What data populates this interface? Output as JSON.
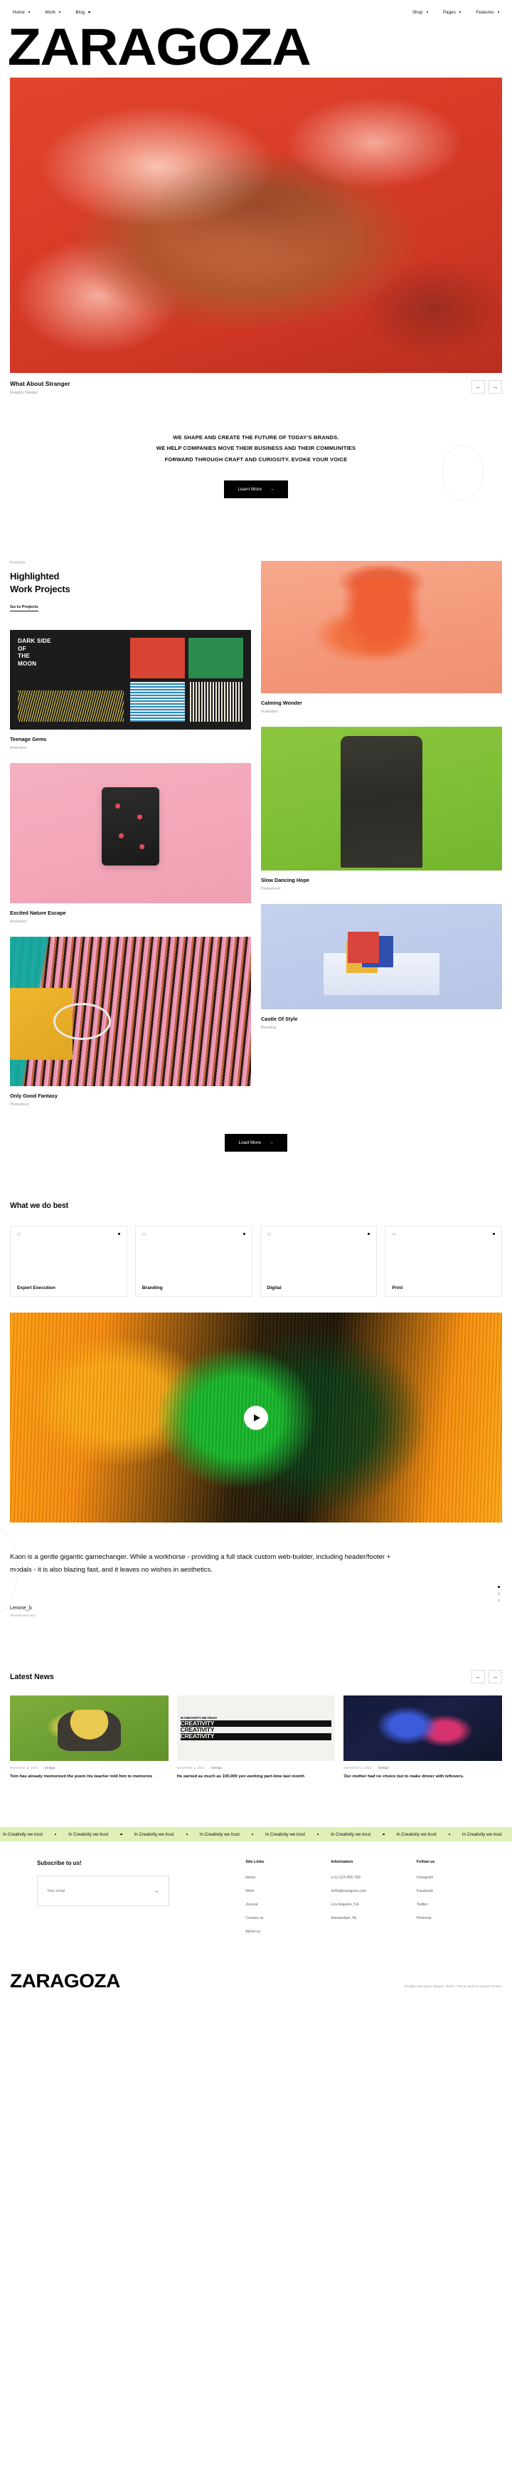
{
  "nav": {
    "left": [
      {
        "label": "Home"
      },
      {
        "label": "Work"
      },
      {
        "label": "Blog"
      }
    ],
    "right": [
      {
        "label": "Shop"
      },
      {
        "label": "Pages"
      },
      {
        "label": "Features"
      }
    ]
  },
  "brand": {
    "wordmark": "ZARAGOZA",
    "footer_logo": "ZARAGOZA"
  },
  "hero": {
    "title": "What About Stranger",
    "category": "Graphic Design",
    "prev_icon": "←",
    "next_icon": "→"
  },
  "statement": {
    "line1": "WE SHAPE AND CREATE THE FUTURE OF TODAY'S BRANDS.",
    "line2": "WE HELP COMPANIES MOVE THEIR BUSINESS AND THEIR COMMUNITIES",
    "line3": "FORWARD THROUGH CRAFT AND CURIOSITY. EVOKE YOUR VOICE",
    "cta": "Learn More",
    "cta_icon": "→"
  },
  "portfolio": {
    "eyebrow": "Portfolio",
    "heading_line1": "Highlighted",
    "heading_line2": "Work Projects",
    "link": "Go to Projects",
    "load_more": "Load More",
    "load_more_icon": "→",
    "moon_art": {
      "l1": "DARK SIDE",
      "l2": "OF",
      "l3": "THE",
      "l4": "MOON"
    },
    "items": [
      {
        "title": "Teenage Gems",
        "category": "Animation"
      },
      {
        "title": "Calming Wonder",
        "category": "Illustration"
      },
      {
        "title": "Excited Nature Escape",
        "category": "Animation"
      },
      {
        "title": "Slow Dancing Hope",
        "category": "Photoshoot"
      },
      {
        "title": "Only Good Fantasy",
        "category": "Photoshoot"
      },
      {
        "title": "Castle Of Style",
        "category": "Branding"
      }
    ]
  },
  "services": {
    "heading": "What we do best",
    "cards": [
      {
        "num": "01",
        "name": "Expert Execution"
      },
      {
        "num": "02",
        "name": "Branding"
      },
      {
        "num": "03",
        "name": "Digital"
      },
      {
        "num": "04",
        "name": "Print"
      }
    ]
  },
  "video": {
    "play_label": "play-button"
  },
  "testimonial": {
    "quote": "Kaon is a gentle gigantic gamechanger. While a workhorse - providing a full stack custom web-builder, including header/footer + modals - it is also blazing fast, and it leaves no wishes in aesthetics.",
    "author": "Lerone_b",
    "role": "Themeforest user"
  },
  "news": {
    "title": "Latest News",
    "prev_icon": "←",
    "next_icon": "→",
    "items": [
      {
        "date": "November 2, 2021",
        "category": "Design",
        "title": "Tom has already memorized the poem his teacher told him to memorize"
      },
      {
        "date": "November 2, 2021",
        "category": "Design",
        "title": "He earned as much as 100,000 yen working part-time last month",
        "art_l1": "IN CREATIVITY WE TRUST",
        "art_l2": "CREATIVITY",
        "art_l3": "CREATIVITY",
        "art_l4": "CREATIVITY"
      },
      {
        "date": "November 2, 2021",
        "category": "Design",
        "title": "Our mother had no choice but to make dinner with leftovers."
      }
    ]
  },
  "marquee": {
    "text": "In Creativity we trust",
    "repeat": 9
  },
  "footer": {
    "subscribe_heading": "Subscribe to us!",
    "email_placeholder": "Your email",
    "submit_icon": "→",
    "columns": [
      {
        "heading": "Site Links",
        "links": [
          "Home",
          "Work",
          "Journal",
          "Contact us",
          "About us"
        ]
      },
      {
        "heading": "Information",
        "links": [
          "(+1)-123-456-789",
          "hello@zaragoza.com",
          "Los Angeles, CA",
          "Amsterdam, NL"
        ]
      },
      {
        "heading": "Follow us",
        "links": [
          "Instagram",
          "Facebook",
          "Twitter",
          "Pinterest"
        ]
      }
    ],
    "copyright": "All rights reserved to Zaragoz, 2023®. Theme made by Neuron Themes."
  }
}
